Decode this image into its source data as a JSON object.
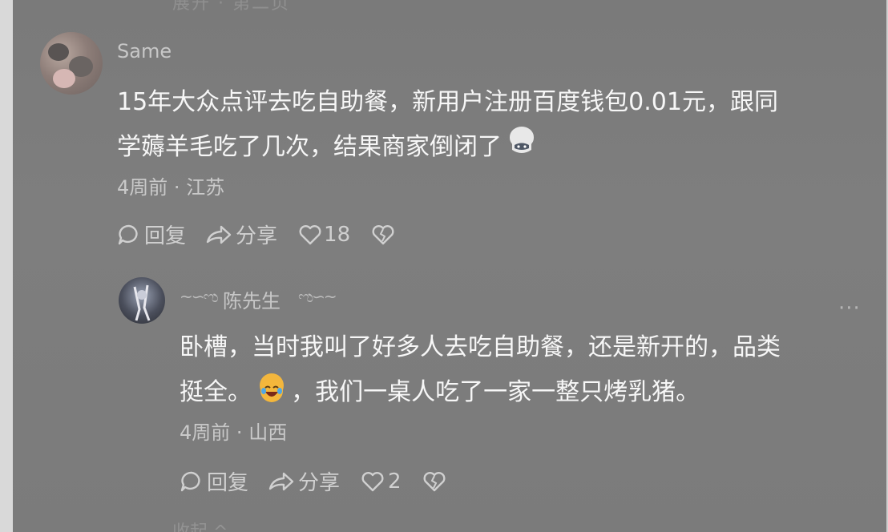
{
  "ghost_top_text": "展开 · 第二页",
  "ghost_bottom_text": "收起 ^",
  "comment": {
    "username": "Same",
    "content_line1": "15年大众点评去吃自助餐，新用户注册百度钱包0.01元，跟同",
    "content_line2": "学薅羊毛吃了几次，结果商家倒闭了",
    "emoji": "cat-face-icon",
    "time": "4周前",
    "separator": "·",
    "location": "江苏",
    "reply_label": "回复",
    "share_label": "分享",
    "like_count": "18"
  },
  "reply": {
    "username": "陈先生",
    "content_line1": "卧槽，当时我叫了好多人去吃自助餐，还是新开的，品类",
    "content_line2_before_emoji": "挺全。",
    "content_line2_after_emoji": "，我们一桌人吃了一家一整只烤乳猪。",
    "emoji": "laughing-face-icon",
    "time": "4周前",
    "separator": "·",
    "location": "山西",
    "reply_label": "回复",
    "share_label": "分享",
    "like_count": "2",
    "more_label": "···"
  },
  "colors": {
    "background": "#7d7d7d",
    "text_primary": "#f7f7f7",
    "text_secondary": "#c9c9c9"
  }
}
